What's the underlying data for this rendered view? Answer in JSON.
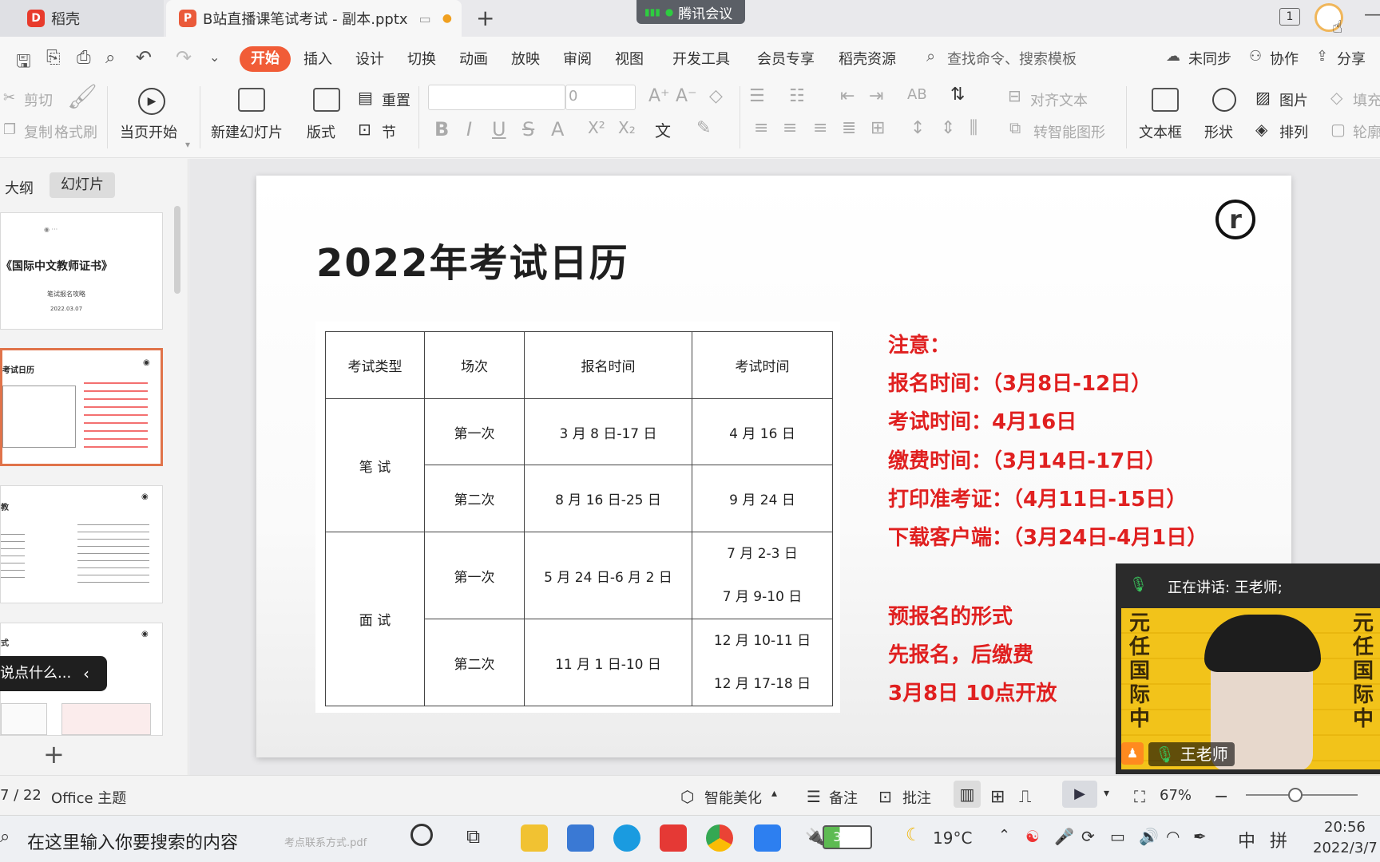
{
  "titlebar": {
    "tab_docer": "稻壳",
    "tab_doc": "B站直播课笔试考试 - 副本.pptx",
    "new_tab": "+",
    "meeting": "腾讯会议",
    "window_num": "1"
  },
  "menu": {
    "items": [
      "开始",
      "插入",
      "设计",
      "切换",
      "动画",
      "放映",
      "审阅",
      "视图",
      "开发工具",
      "会员专享",
      "稻壳资源"
    ],
    "search_placeholder": "查找命令、搜索模板",
    "sync": "未同步",
    "collab": "协作",
    "share": "分享"
  },
  "ribbon": {
    "cut": "剪切",
    "copy": "复制",
    "format_painter": "格式刷",
    "play_current": "当页开始",
    "new_slide": "新建幻灯片",
    "layout": "版式",
    "reset": "重置",
    "section": "节",
    "font_size": "0",
    "align_text": "对齐文本",
    "smart_shape": "转智能图形",
    "textbox": "文本框",
    "shape": "形状",
    "picture": "图片",
    "arrange": "排列",
    "fill": "填充",
    "outline": "轮廓"
  },
  "leftpanel": {
    "tab_outline": "大纲",
    "tab_slides": "幻灯片",
    "thumb1_title": "《国际中文教师证书》",
    "thumb1_sub": "笔试报名攻略",
    "thumb1_date": "2022.03.07",
    "thumb2_title": "考试日历",
    "thumb3_title": "教",
    "thumb4_title": "式",
    "comment_prompt": "说点什么...",
    "add": "+"
  },
  "slide": {
    "title": "2022年考试日历",
    "table": {
      "headers": [
        "考试类型",
        "场次",
        "报名时间",
        "考试时间"
      ],
      "written": "笔 试",
      "interview": "面 试",
      "rows": [
        {
          "session": "第一次",
          "register": "3 月 8 日-17 日",
          "exam": "4 月 16 日"
        },
        {
          "session": "第二次",
          "register": "8 月 16 日-25 日",
          "exam": "9 月 24 日"
        },
        {
          "session": "第一次",
          "register": "5 月 24 日-6 月 2 日",
          "exam1": "7 月 2-3 日",
          "exam2": "7 月 9-10 日"
        },
        {
          "session": "第二次",
          "register": "11 月 1 日-10 日",
          "exam1": "12 月 10-11 日",
          "exam2": "12 月 17-18 日"
        }
      ]
    },
    "notes": [
      "注意：",
      "报名时间：（3月8日-12日）",
      "考试时间：4月16日",
      "缴费时间：（3月14日-17日）",
      "打印准考证：（4月11日-15日）",
      "下载客户端：（3月24日-4月1日）",
      "预报名的形式",
      "先报名，后缴费",
      "3月8日  10点开放"
    ]
  },
  "video": {
    "speaking": "正在讲话: 王老师;",
    "name": "王老师"
  },
  "statusbar": {
    "page": "7 / 22",
    "theme": "Office 主题",
    "beautify": "智能美化",
    "notes": "备注",
    "comment": "批注",
    "zoom": "67%"
  },
  "taskbar": {
    "search": "在这里输入你要搜索的内容",
    "file_hint": "考点联系方式.pdf",
    "battery": "34%",
    "temp": "19°C",
    "ime1": "中",
    "ime2": "拼",
    "time": "20:56",
    "date": "2022/3/7"
  }
}
